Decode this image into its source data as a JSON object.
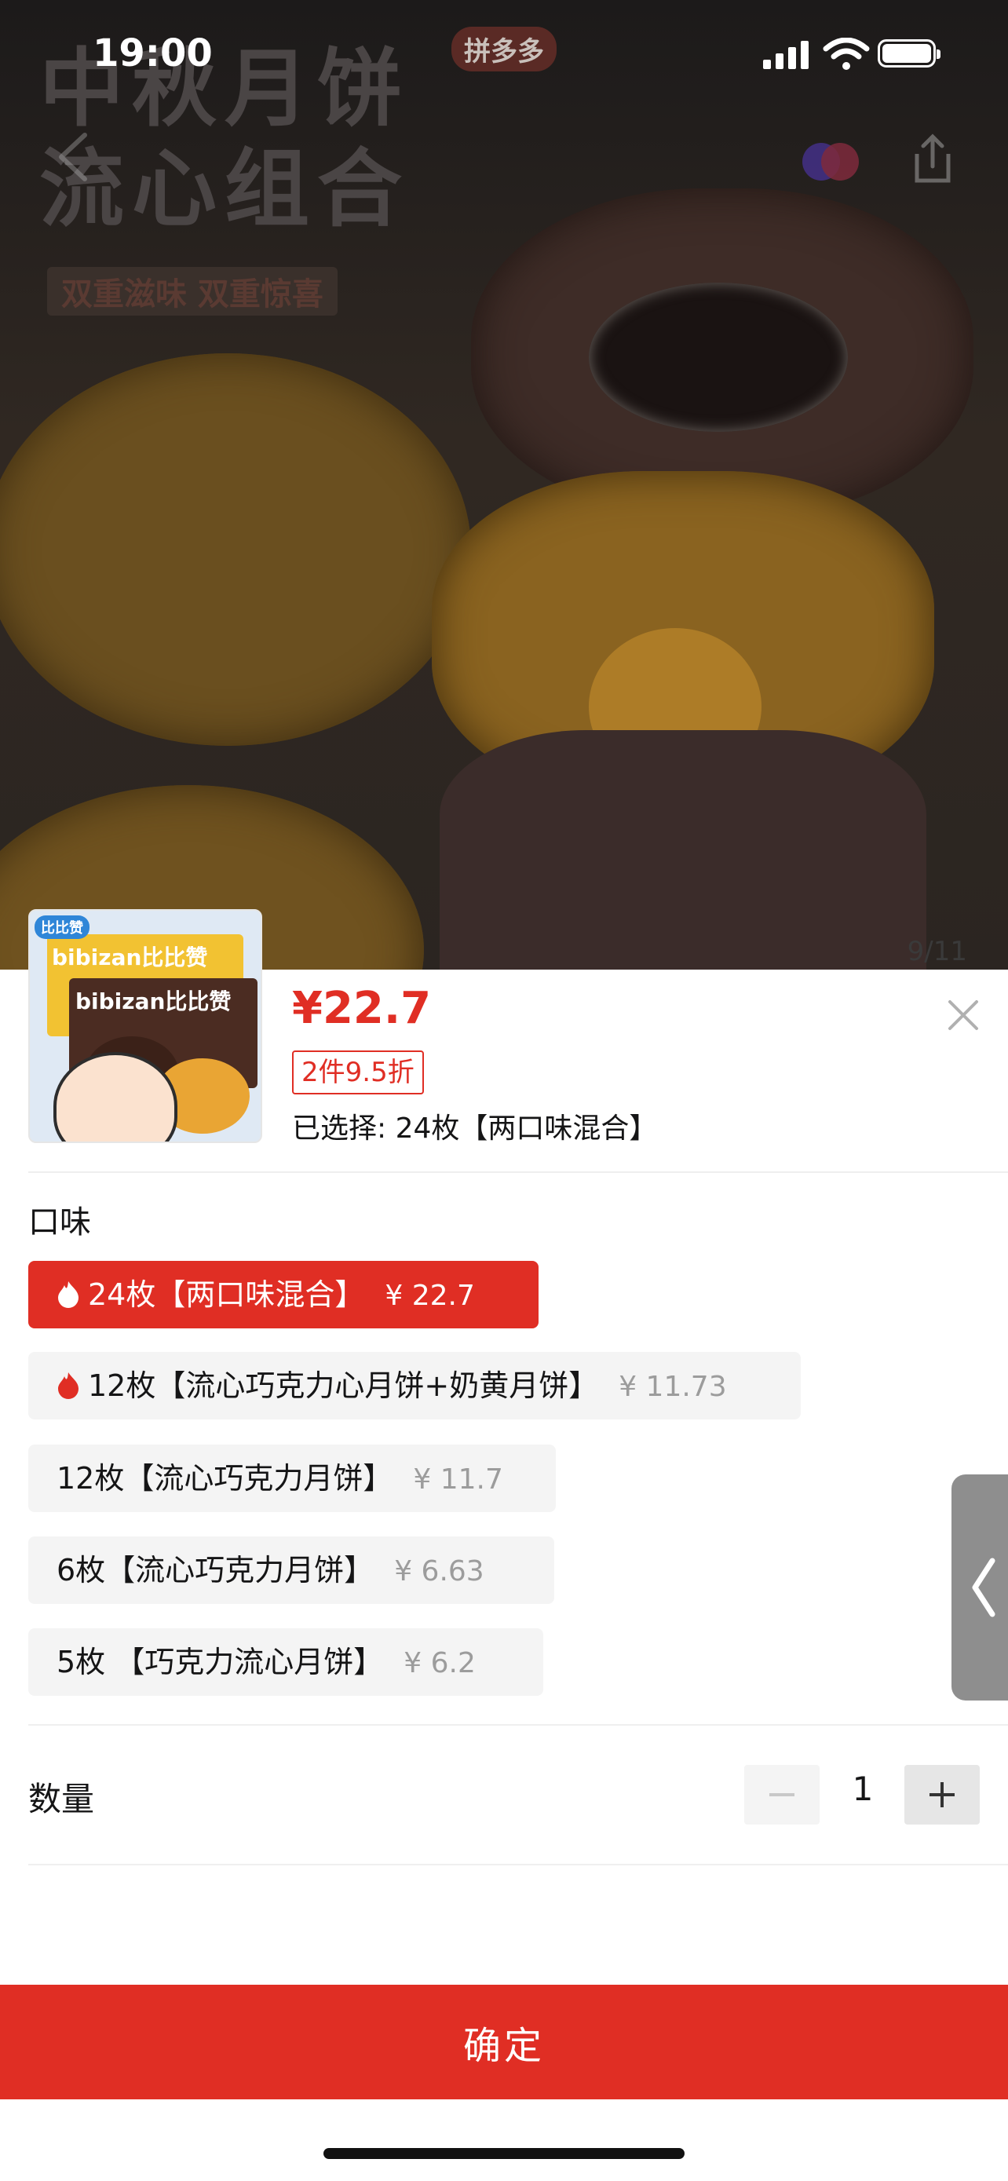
{
  "status_bar": {
    "time": "19:00"
  },
  "hero": {
    "title": "中秋月饼\n流心组合",
    "subtitle": "双重滋味 双重惊喜",
    "badge": "拼多多",
    "page_indicator": "9/11"
  },
  "thumbnail": {
    "brand_top": "bibizan比比赞",
    "brand_bottom": "bibizan比比赞",
    "logo": "比比赞"
  },
  "product": {
    "price": "¥22.7",
    "discount": "2件9.5折",
    "selected": "已选择: 24枚【两口味混合】"
  },
  "flavor": {
    "label": "口味",
    "options": [
      {
        "label": "24枚【两口味混合】",
        "price": "¥ 22.7",
        "hot": true,
        "selected": true
      },
      {
        "label": "12枚【流心巧克力心月饼+奶黄月饼】",
        "price": "¥ 11.73",
        "hot": true,
        "selected": false
      },
      {
        "label": "12枚【流心巧克力月饼】",
        "price": "¥ 11.7",
        "hot": false,
        "selected": false
      },
      {
        "label": "6枚【流心巧克力月饼】",
        "price": "¥ 6.63",
        "hot": false,
        "selected": false
      },
      {
        "label": "5枚 【巧克力流心月饼】",
        "price": "¥ 6.2",
        "hot": false,
        "selected": false
      }
    ]
  },
  "quantity": {
    "label": "数量",
    "value": "1"
  },
  "confirm_label": "确定",
  "icons": {
    "back": "chevron-left-icon",
    "favorite": "favorite-icon",
    "share": "share-icon",
    "close": "close-icon",
    "flame": "flame-icon",
    "side_tab": "chevron-left-icon"
  },
  "colors": {
    "accent": "#e02e24",
    "option_bg": "#f4f4f4",
    "muted_price": "#9c9c9c"
  }
}
